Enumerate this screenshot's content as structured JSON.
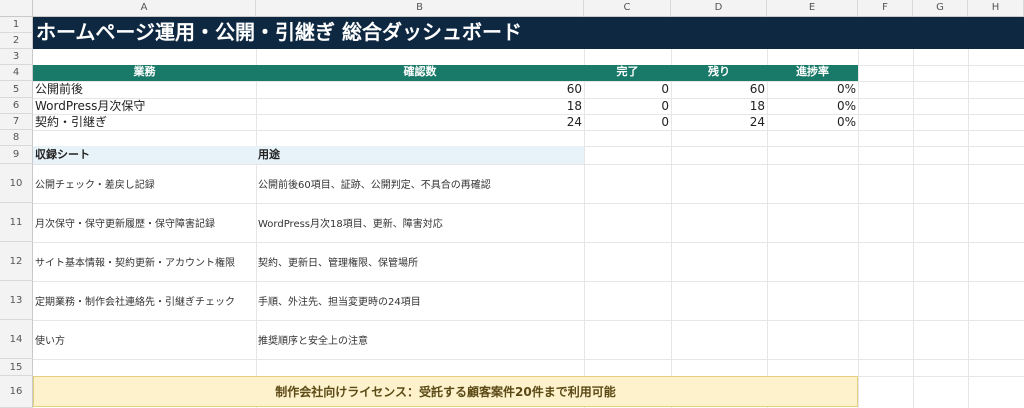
{
  "sheet": {
    "columns": [
      "A",
      "B",
      "C",
      "D",
      "E",
      "F",
      "G",
      "H"
    ],
    "rows": [
      "1",
      "2",
      "3",
      "4",
      "5",
      "6",
      "7",
      "8",
      "9",
      "10",
      "11",
      "12",
      "13",
      "14",
      "15",
      "16"
    ]
  },
  "title": "ホームページ運用・公開・引継ぎ 総合ダッシュボード",
  "summary": {
    "headers": [
      "業務",
      "確認数",
      "完了",
      "残り",
      "進捗率"
    ],
    "rows": [
      {
        "task": "公開前後",
        "count": "60",
        "done": "0",
        "remaining": "60",
        "progress": "0%"
      },
      {
        "task": "WordPress月次保守",
        "count": "18",
        "done": "0",
        "remaining": "18",
        "progress": "0%"
      },
      {
        "task": "契約・引継ぎ",
        "count": "24",
        "done": "0",
        "remaining": "24",
        "progress": "0%"
      }
    ]
  },
  "sheets_section": {
    "header_sheet": "収録シート",
    "header_use": "用途",
    "items": [
      {
        "sheet": "公開チェック・差戻し記録",
        "use": "公開前後60項目、証跡、公開判定、不具合の再確認"
      },
      {
        "sheet": "月次保守・保守更新履歴・保守障害記録",
        "use": "WordPress月次18項目、更新、障害対応"
      },
      {
        "sheet": "サイト基本情報・契約更新・アカウント権限",
        "use": "契約、更新日、管理権限、保管場所"
      },
      {
        "sheet": "定期業務・制作会社連絡先・引継ぎチェック",
        "use": "手順、外注先、担当変更時の24項目"
      },
      {
        "sheet": "使い方",
        "use": "推奨順序と安全上の注意"
      }
    ]
  },
  "license": "制作会社向けライセンス：受託する顧客案件20件まで利用可能",
  "colors": {
    "title_bg": "#0e2841",
    "header_bg": "#1a7a69",
    "license_bg": "#fdf2cc",
    "band_bg": "#e8f2f9"
  }
}
